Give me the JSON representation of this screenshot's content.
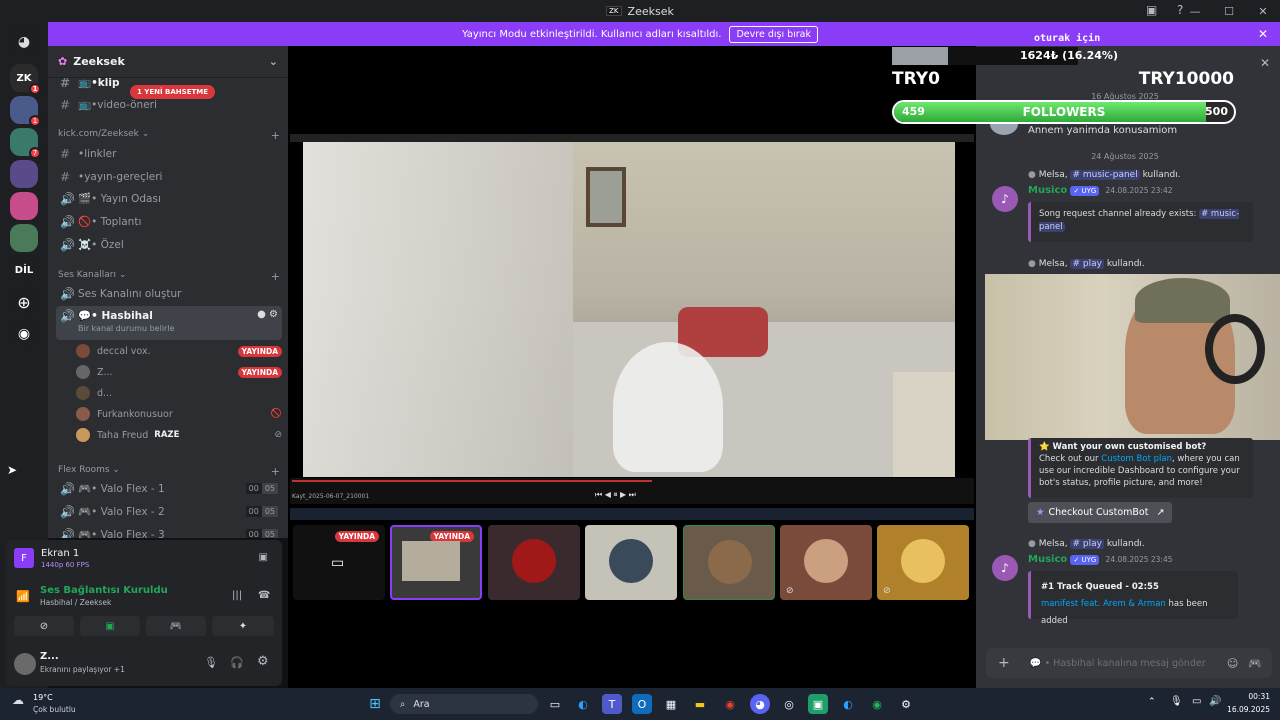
{
  "window": {
    "title": "Zeeksek",
    "logo_text": "ZK"
  },
  "streamer_bar": {
    "message": "Yayıncı Modu etkinleştirildi. Kullanıcı adları kısaltıldı.",
    "button": "Devre dışı bırak"
  },
  "servers": [
    {
      "label": "ZK",
      "badge": "1",
      "color": "#2b2b2b"
    },
    {
      "label": "",
      "badge": "1",
      "color": "#4a5a8a"
    },
    {
      "label": "",
      "badge": "7",
      "color": "#3a7a6a"
    },
    {
      "label": "",
      "badge": "",
      "color": "#5a4a8a"
    },
    {
      "label": "",
      "badge": "",
      "color": "#c74d8a"
    },
    {
      "label": "",
      "badge": "",
      "color": "#4a7a5a"
    },
    {
      "label": "DİL",
      "badge": "",
      "color": "#1e1f22"
    }
  ],
  "guild": {
    "name": "Zeeksek"
  },
  "mention_pill": "1 YENİ BAHSETME",
  "channels_top": [
    {
      "name": "📺•klip"
    },
    {
      "name": "📺•video-öneri"
    }
  ],
  "category_kick": "kick.com/Zeeksek",
  "channels_kick": [
    {
      "name": "•linkler",
      "type": "text"
    },
    {
      "name": "•yayın-gereçleri",
      "type": "text"
    },
    {
      "name": "🎬• Yayın Odası",
      "type": "voice"
    },
    {
      "name": "🚫• Toplantı",
      "type": "voice"
    },
    {
      "name": "☠️• Özel",
      "type": "voice"
    }
  ],
  "category_voice": "Ses Kanalları",
  "create_voice": "Ses Kanalını oluştur",
  "active_channel": {
    "name": "💬• Hasbihal",
    "status": "Bir kanal durumu belirle"
  },
  "voice_users": [
    {
      "name": "deccal vox.",
      "live": "YAYINDA"
    },
    {
      "name": "Z...",
      "live": "YAYINDA"
    },
    {
      "name": "d...",
      "live": ""
    },
    {
      "name": "Furkankonusuor",
      "live": ""
    },
    {
      "name": "Taha Freud",
      "tag": "RAZE",
      "live": ""
    }
  ],
  "category_flex": "Flex Rooms",
  "flex_rooms": [
    {
      "name": "🎮• Valo Flex - 1",
      "a": "00",
      "b": "05"
    },
    {
      "name": "🎮• Valo Flex - 2",
      "a": "00",
      "b": "05"
    },
    {
      "name": "🎮• Valo Flex - 3",
      "a": "00",
      "b": "05"
    }
  ],
  "stream_panel": {
    "title": "Ekran 1",
    "quality": "1440p 60 FPS"
  },
  "voice_status": {
    "title": "Ses Bağlantısı Kuruldu",
    "channel": "Hasbihal / Zeeksek"
  },
  "user": {
    "name": "Z...",
    "status": "Ekranını paylaşıyor +1"
  },
  "player": {
    "filename": "Kayt_2025-06-07_210001"
  },
  "thumbnails": [
    {
      "live": "YAYINDA"
    },
    {
      "live": "YAYINDA"
    },
    {
      "live": ""
    },
    {
      "live": ""
    },
    {
      "live": ""
    },
    {
      "live": ""
    },
    {
      "live": ""
    }
  ],
  "overlay": {
    "top_label": "oturak için",
    "amount": "1624₺ (16.24%)",
    "left_goal": "TRY0",
    "right_goal": "TRY10000",
    "followers_current": "459",
    "followers_label": "FOLLOWERS",
    "followers_target": "500",
    "followers_progress": 0.918
  },
  "chat": {
    "date1": "16 Ağustos 2025",
    "msg1": "Annem yanimda konusamiom",
    "date2": "24 Ağustos 2025",
    "used1_user": "Melsa,",
    "used1_cmd": "# music-panel",
    "used_word": "kullandı.",
    "bot_name": "Musico",
    "bot_tag": "✓ UYG",
    "time1": "24.08.2025 23:42",
    "embed1_text": "Song request channel already exists:",
    "embed1_link": "# music-panel",
    "used2_cmd": "# play",
    "embed2_title": "⭐ Want your own customised bot?",
    "embed2_text1": "Check out our",
    "embed2_link": "Custom Bot plan",
    "embed2_text2": ", where you can use our incredible Dashboard to configure your bot's status, profile picture, and more!",
    "embed2_button": "Checkout CustomBot",
    "time2": "24.08.2025 23:45",
    "embed3_title": "#1 Track Queued - 02:55",
    "embed3_track": "manifest feat. Arem & Arman",
    "embed3_suffix": "has been added",
    "input_placeholder": "💬 • Hasbihal kanalına mesaj gönder"
  },
  "taskbar": {
    "weather_temp": "19°C",
    "weather_desc": "Çok bulutlu",
    "search": "Ara",
    "time": "00:31",
    "date": "16.09.2025"
  }
}
